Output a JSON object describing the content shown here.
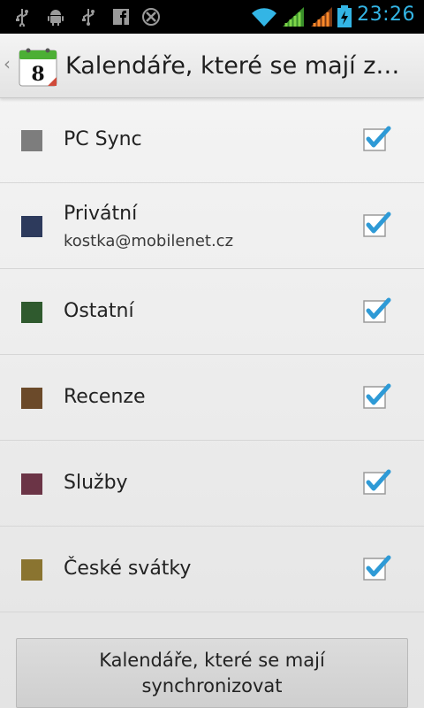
{
  "status_bar": {
    "time": "23:26",
    "icons": [
      "usb-icon",
      "android-debug-icon",
      "usb-icon",
      "facebook-icon",
      "app-x-icon",
      "wifi-icon",
      "signal-icon",
      "signal-roaming-icon",
      "battery-charging-icon"
    ]
  },
  "action_bar": {
    "title": "Kalendáře, které se mají zobrazit",
    "app_icon_day": "8"
  },
  "calendars": [
    {
      "label": "PC Sync",
      "subtitle": "",
      "color": "#7d7d7d",
      "checked": true
    },
    {
      "label": "Privátní",
      "subtitle": "kostka@mobilenet.cz",
      "color": "#2d3a5c",
      "checked": true
    },
    {
      "label": "Ostatní",
      "subtitle": "",
      "color": "#2f5a2e",
      "checked": true
    },
    {
      "label": "Recenze",
      "subtitle": "",
      "color": "#6b4a2a",
      "checked": true
    },
    {
      "label": "Služby",
      "subtitle": "",
      "color": "#6b3446",
      "checked": true
    },
    {
      "label": "České svátky",
      "subtitle": "",
      "color": "#8a7430",
      "checked": true
    }
  ],
  "sync_button": {
    "label": "Kalendáře, které se mají synchronizovat"
  },
  "colors": {
    "accent": "#33b5e5",
    "check_tick": "#2e9ad6"
  }
}
